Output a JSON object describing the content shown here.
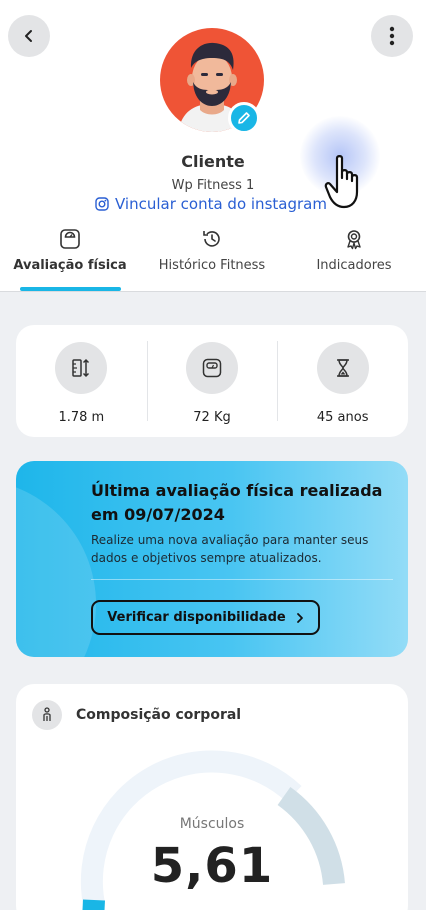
{
  "profile": {
    "name": "Cliente",
    "gym": "Wp Fitness 1",
    "instagram_link": "Vincular conta do instagram"
  },
  "tabs": [
    {
      "label": "Avaliação física",
      "icon": "scale-icon",
      "active": true
    },
    {
      "label": "Histórico Fitness",
      "icon": "history-icon",
      "active": false
    },
    {
      "label": "Indicadores",
      "icon": "award-icon",
      "active": false
    }
  ],
  "stats": [
    {
      "value": "1.78 m",
      "icon": "height-ruler-icon"
    },
    {
      "value": "72 Kg",
      "icon": "weight-scale-icon"
    },
    {
      "value": "45 anos",
      "icon": "hourglass-icon"
    }
  ],
  "promo": {
    "title": "Última avaliação física realizada em  09/07/2024",
    "text": "Realize uma nova avaliação para manter seus dados e objetivos sempre atualizados.",
    "button": "Verificar disponibilidade",
    "button_icon": "chevron-right-icon"
  },
  "composition": {
    "title": "Composição corporal",
    "gauge_label": "Músculos",
    "gauge_value": "5,61"
  },
  "colors": {
    "accent": "#19b6e6",
    "avatar_bg": "#ef5436",
    "link": "#2a5fd3"
  }
}
